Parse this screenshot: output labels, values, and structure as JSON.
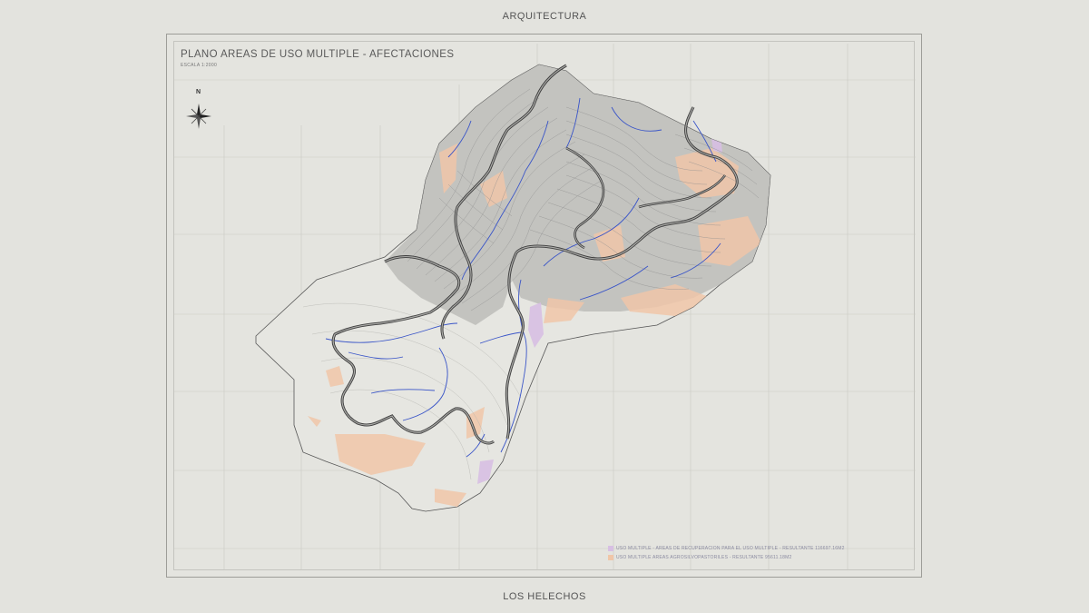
{
  "header": {
    "discipline": "ARQUITECTURA"
  },
  "footer": {
    "project": "LOS HELECHOS"
  },
  "plan": {
    "title": "PLANO AREAS DE USO MULTIPLE - AFECTACIONES",
    "scale": "ESCALA 1:2000",
    "north": "N"
  },
  "legend": [
    {
      "text": "USO MULTIPLE - AREAS DE RECUPERACION PARA EL USO MULTIPLE - RESULTANTE 116697.16M2",
      "color": "#d7bfe3"
    },
    {
      "text": "USO MULTIPLE AREAS AGROSILVOPASTORILES - RESULTANTE 95611.18M2",
      "color": "#f0c6a8"
    }
  ],
  "colors": {
    "background": "#e3e3de",
    "contour": "#8f8f8f",
    "stream": "#3a55c8",
    "road": "#4a4a4a",
    "agro": "#f0c6a8",
    "recovery": "#d7bfe3",
    "hillshade": "#b9b9b6"
  }
}
